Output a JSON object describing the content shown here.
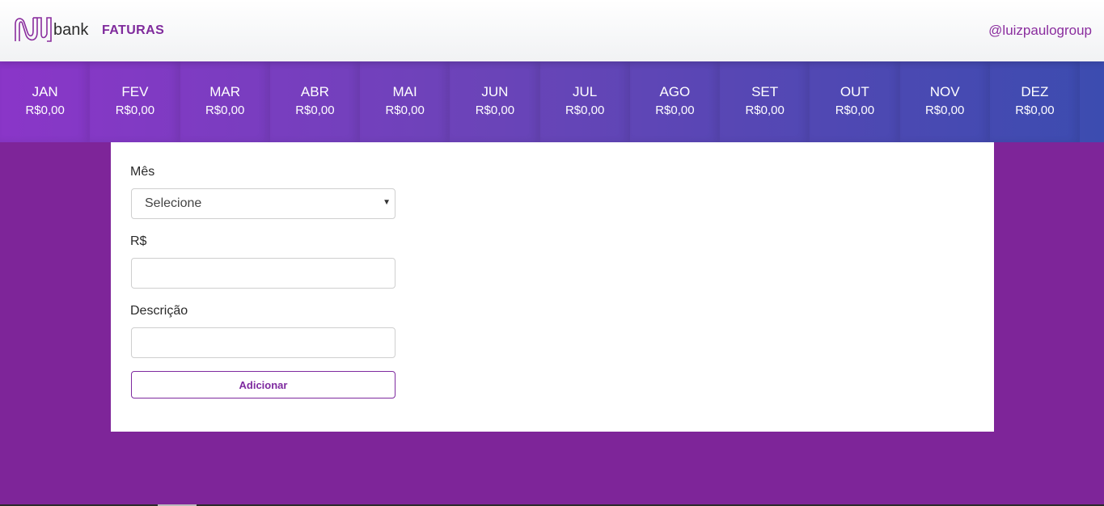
{
  "header": {
    "logo_text": "bank",
    "title": "FATURAS",
    "user": "@luizpaulogroup"
  },
  "months": [
    {
      "name": "JAN",
      "value": "R$0,00"
    },
    {
      "name": "FEV",
      "value": "R$0,00"
    },
    {
      "name": "MAR",
      "value": "R$0,00"
    },
    {
      "name": "ABR",
      "value": "R$0,00"
    },
    {
      "name": "MAI",
      "value": "R$0,00"
    },
    {
      "name": "JUN",
      "value": "R$0,00"
    },
    {
      "name": "JUL",
      "value": "R$0,00"
    },
    {
      "name": "AGO",
      "value": "R$0,00"
    },
    {
      "name": "SET",
      "value": "R$0,00"
    },
    {
      "name": "OUT",
      "value": "R$0,00"
    },
    {
      "name": "NOV",
      "value": "R$0,00"
    },
    {
      "name": "DEZ",
      "value": "R$0,00"
    }
  ],
  "form": {
    "month_label": "Mês",
    "month_selected": "Selecione",
    "amount_label": "R$",
    "amount_value": "",
    "description_label": "Descrição",
    "description_value": "",
    "submit_label": "Adicionar"
  },
  "colors": {
    "brand": "#7e2599",
    "accent": "#8a2d9e"
  }
}
